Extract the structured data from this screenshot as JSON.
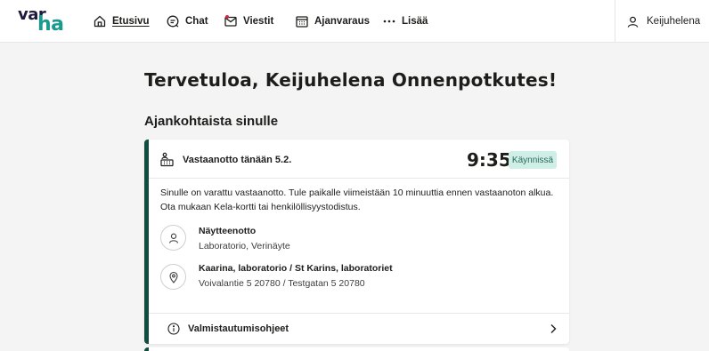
{
  "logo": {
    "part1": "var",
    "part2": "ha"
  },
  "nav": {
    "items": [
      {
        "label": "Etusivu",
        "icon": "home-icon"
      },
      {
        "label": "Chat",
        "icon": "chat-icon"
      },
      {
        "label": "Viestit",
        "icon": "message-icon"
      },
      {
        "label": "Ajanvaraus",
        "icon": "calendar-icon"
      },
      {
        "label": "Lisää",
        "icon": "more-icon"
      }
    ],
    "user": {
      "name": "Keijuhelena",
      "icon": "user-icon"
    }
  },
  "main": {
    "page_title": "Tervetuloa, Keijuhelena Onnenpotkutes!",
    "section_title": "Ajankohtaista sinulle",
    "card": {
      "title": "Vastaanotto tänään 5.2.",
      "time": "9:35",
      "status_badge": "Käynnissä",
      "text": "Sinulle on varattu vastaanotto. Tule paikalle viimeistään 10 minuuttia ennen vastaanoton alkua. Ota mukaan Kela-kortti tai henkilöllisyystodistus.",
      "service": {
        "name": "Näytteenotto",
        "detail": "Laboratorio, Verinäyte",
        "icon": "person-icon"
      },
      "location": {
        "name": "Kaarina, laboratorio / St Karins, laboratoriet",
        "detail": "Voivalantie 5 20780 / Testgatan 5 20780",
        "icon": "location-icon"
      },
      "footer_label": "Valmistautumisohjeet"
    }
  },
  "colors": {
    "brand_dark": "#1f1a3c",
    "brand_teal": "#1a9a8c",
    "card_accent": "#114d3f",
    "badge_bg": "#cfeee6",
    "badge_text": "#276b5a",
    "background": "#f4f4f4"
  }
}
